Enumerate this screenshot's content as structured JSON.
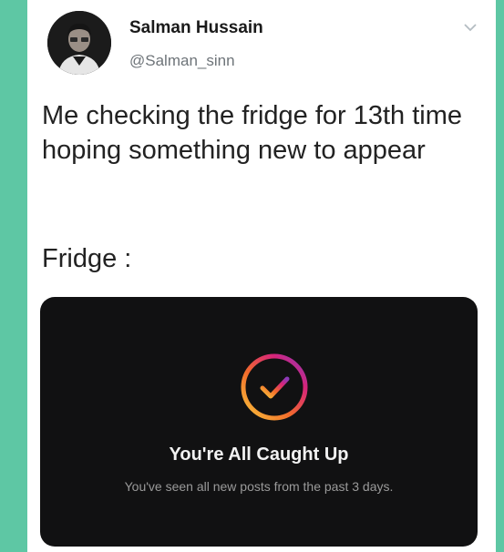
{
  "tweet": {
    "author": {
      "display_name": "Salman Hussain",
      "handle": "@Salman_sinn"
    },
    "text": "Me checking the fridge for 13th time hoping something new to appear",
    "label": "Fridge :",
    "embedded_screen": {
      "title": "You're All Caught Up",
      "subtitle": "You've seen all new posts from the past 3 days."
    }
  },
  "colors": {
    "side_background": "#5ec7a4",
    "card_background": "#ffffff",
    "media_background": "#111112",
    "ring_gradient": [
      "#f9c63b",
      "#f26b2b",
      "#d6247a",
      "#8a3ab9"
    ]
  },
  "icons": [
    "avatar",
    "chevron-down-icon",
    "checkmark-circle-icon"
  ]
}
